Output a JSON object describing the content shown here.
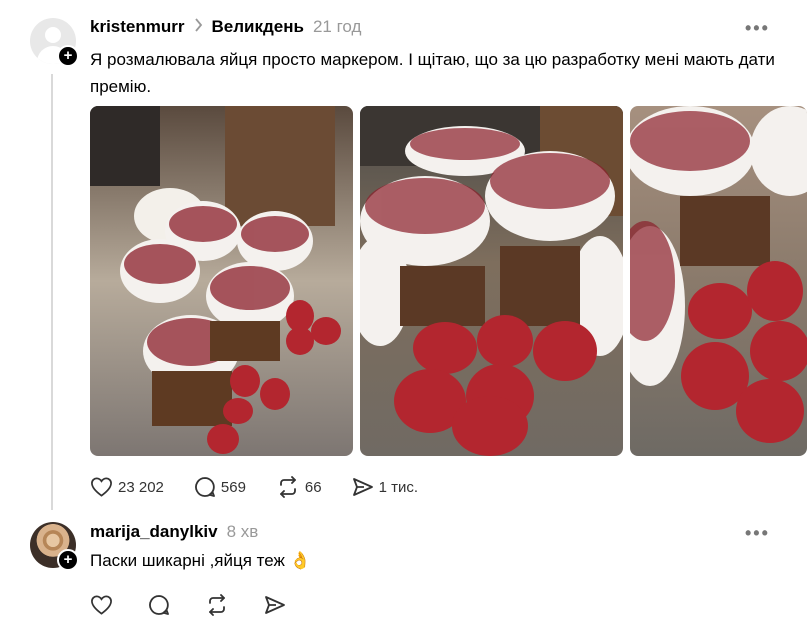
{
  "post": {
    "username": "kristenmurr",
    "topic": "Великдень",
    "time": "21 год",
    "text": "Я розмалювала яйця просто маркером. І щітаю, що за цю разработку мені мають дати премію.",
    "images": [
      {
        "description_icon": "easter-cakes-photo-1"
      },
      {
        "description_icon": "easter-cakes-photo-2"
      },
      {
        "description_icon": "easter-cakes-photo-3"
      }
    ],
    "actions": {
      "likes": "23 202",
      "comments": "569",
      "reposts": "66",
      "shares": "1 тис."
    }
  },
  "comment": {
    "username": "marija_danylkiv",
    "time": "8 хв",
    "text": "Паски шикарні ,яйця теж 👌"
  },
  "colors": {
    "muted": "#999999",
    "divider": "#d9d9d9",
    "egg": "#b3262f",
    "icing": "#f4f1ee"
  }
}
